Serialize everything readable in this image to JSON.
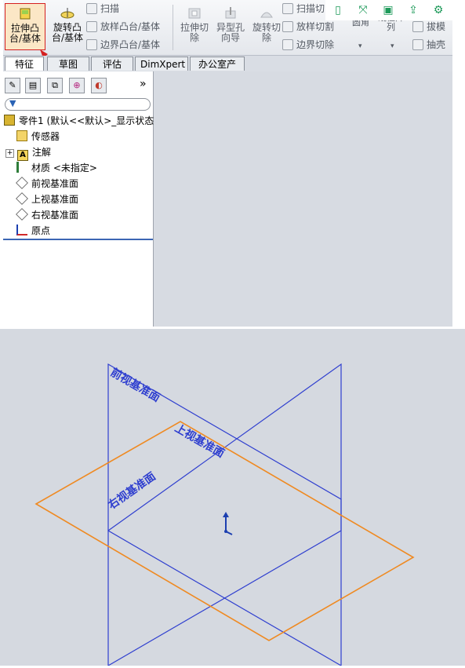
{
  "ribbon": {
    "extrude_boss": {
      "line1": "拉伸凸",
      "line2": "台/基体"
    },
    "revolve_boss": {
      "line1": "旋转凸",
      "line2": "台/基体"
    },
    "sweep": "扫描",
    "loft_boss": "放样凸台/基体",
    "boundary_boss": "边界凸台/基体",
    "extrude_cut": {
      "line1": "拉伸切",
      "line2": "除"
    },
    "hole_wizard": {
      "line1": "异型孔",
      "line2": "向导"
    },
    "revolve_cut": {
      "line1": "旋转切",
      "line2": "除"
    },
    "swept_cut": "扫描切",
    "loft_cut": "放样切割",
    "boundary_cut": "边界切除",
    "fillet": "圆角",
    "linear_pattern": {
      "line1": "线性阵",
      "line2": "列"
    },
    "draft": "拔模",
    "shell": "抽壳"
  },
  "tabs": [
    "特征",
    "草图",
    "评估",
    "DimXpert",
    "办公室产品"
  ],
  "tree": {
    "part": "零件1 (默认<<默认>_显示状态",
    "sensors": "传感器",
    "annotations": "注解",
    "material": "材质 <未指定>",
    "front_plane": "前视基准面",
    "top_plane": "上视基准面",
    "right_plane": "右视基准面",
    "origin": "原点"
  },
  "panel_more": "»",
  "viewport": {
    "front_plane_label": "前视基准面",
    "top_plane_label": "上视基准面",
    "right_plane_label": "右视基准面"
  },
  "colors": {
    "plane_blue": "#2f3fcf",
    "plane_orange": "#ef8a22",
    "highlight_red": "#d42020",
    "accent_green": "#1e9a5a"
  }
}
